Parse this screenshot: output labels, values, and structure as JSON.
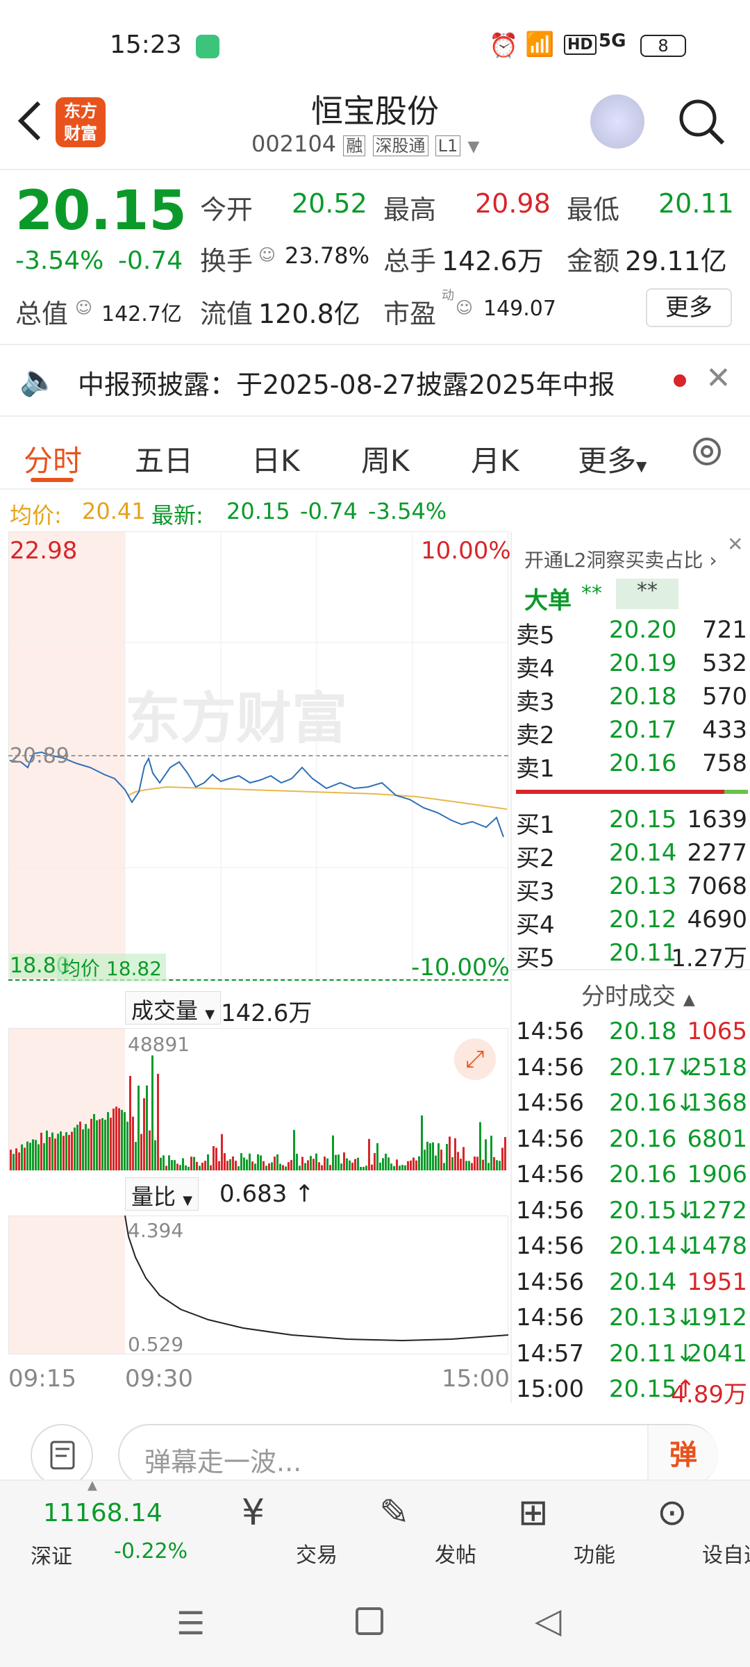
{
  "status": {
    "time": "15:23",
    "battery": "8"
  },
  "header": {
    "app_logo": "东方\n财富",
    "stock_name": "恒宝股份",
    "code": "002104",
    "tags": [
      "融",
      "深股通",
      "L1"
    ]
  },
  "quote": {
    "price": "20.15",
    "change_pct": "-3.54%",
    "change": "-0.74",
    "open_label": "今开",
    "open": "20.52",
    "high_label": "最高",
    "high": "20.98",
    "low_label": "最低",
    "low": "20.11",
    "turnover_label": "换手",
    "turnover": "23.78%",
    "volume_label": "总手",
    "volume": "142.6万",
    "amount_label": "金额",
    "amount": "29.11亿",
    "mktcap_label": "总值",
    "mktcap": "142.7亿",
    "float_label": "流值",
    "float": "120.8亿",
    "pe_label": "市盈",
    "pe_sup": "动",
    "pe": "149.07",
    "more": "更多"
  },
  "notice": {
    "text": "中报预披露：于2025-08-27披露2025年中报"
  },
  "tabs": [
    "分时",
    "五日",
    "日K",
    "周K",
    "月K",
    "更多",
    ""
  ],
  "avg_bar": {
    "avg_label": "均价:",
    "avg": "20.41",
    "latest_label": "最新:",
    "latest": "20.15",
    "chg": "-0.74",
    "pct": "-3.54%"
  },
  "chart": {
    "top_price": "22.98",
    "top_pct": "10.00%",
    "mid_price": "20.89",
    "bottom_price": "18.80",
    "bottom_pct": "-10.00%",
    "avg_tag": "均价 18.82",
    "watermark": "东方财富",
    "vol_label": "成交量",
    "vol_value": "142.6万",
    "vol_max": "48891",
    "lb_label": "量比",
    "lb_value": "0.683",
    "lb_max": "4.394",
    "lb_min": "0.529",
    "time_start": "09:15",
    "time_open": "09:30",
    "time_end": "15:00"
  },
  "orderbook": {
    "promo": "开通L2洞察买卖占比",
    "big_order_label": "大单",
    "big_order_v1": "**",
    "big_order_v2": "**",
    "asks": [
      {
        "label": "卖5",
        "price": "20.20",
        "vol": "721"
      },
      {
        "label": "卖4",
        "price": "20.19",
        "vol": "532"
      },
      {
        "label": "卖3",
        "price": "20.18",
        "vol": "570"
      },
      {
        "label": "卖2",
        "price": "20.17",
        "vol": "433"
      },
      {
        "label": "卖1",
        "price": "20.16",
        "vol": "758"
      }
    ],
    "bids": [
      {
        "label": "买1",
        "price": "20.15",
        "vol": "1639"
      },
      {
        "label": "买2",
        "price": "20.14",
        "vol": "2277"
      },
      {
        "label": "买3",
        "price": "20.13",
        "vol": "7068"
      },
      {
        "label": "买4",
        "price": "20.12",
        "vol": "4690"
      },
      {
        "label": "买5",
        "price": "20.11",
        "vol": "1.27万"
      }
    ],
    "ticks_title": "分时成交",
    "ticks": [
      {
        "time": "14:56",
        "price": "20.18",
        "dir": "",
        "vol": "1065",
        "col": "red"
      },
      {
        "time": "14:56",
        "price": "20.17",
        "dir": "↓",
        "vol": "2518",
        "col": "green"
      },
      {
        "time": "14:56",
        "price": "20.16",
        "dir": "↓",
        "vol": "1368",
        "col": "green"
      },
      {
        "time": "14:56",
        "price": "20.16",
        "dir": "",
        "vol": "6801",
        "col": "green"
      },
      {
        "time": "14:56",
        "price": "20.16",
        "dir": "",
        "vol": "1906",
        "col": "green"
      },
      {
        "time": "14:56",
        "price": "20.15",
        "dir": "↓",
        "vol": "1272",
        "col": "green"
      },
      {
        "time": "14:56",
        "price": "20.14",
        "dir": "↓",
        "vol": "1478",
        "col": "green"
      },
      {
        "time": "14:56",
        "price": "20.14",
        "dir": "",
        "vol": "1951",
        "col": "red"
      },
      {
        "time": "14:56",
        "price": "20.13",
        "dir": "↓",
        "vol": "1912",
        "col": "green"
      },
      {
        "time": "14:57",
        "price": "20.11",
        "dir": "↓",
        "vol": "2041",
        "col": "green"
      },
      {
        "time": "15:00",
        "price": "20.15",
        "dir": "↑",
        "vol": "4.89万",
        "col": "red"
      }
    ]
  },
  "comment": {
    "placeholder": "弹幕走一波...",
    "barrage": "弹"
  },
  "dock": {
    "index_value": "11168.14",
    "index_name": "深证",
    "index_chg": "-0.22%",
    "items": [
      "交易",
      "发帖",
      "功能",
      "设自选"
    ]
  },
  "colors": {
    "up": "#d8252a",
    "down": "#0b9a2a",
    "accent": "#e8531d"
  }
}
